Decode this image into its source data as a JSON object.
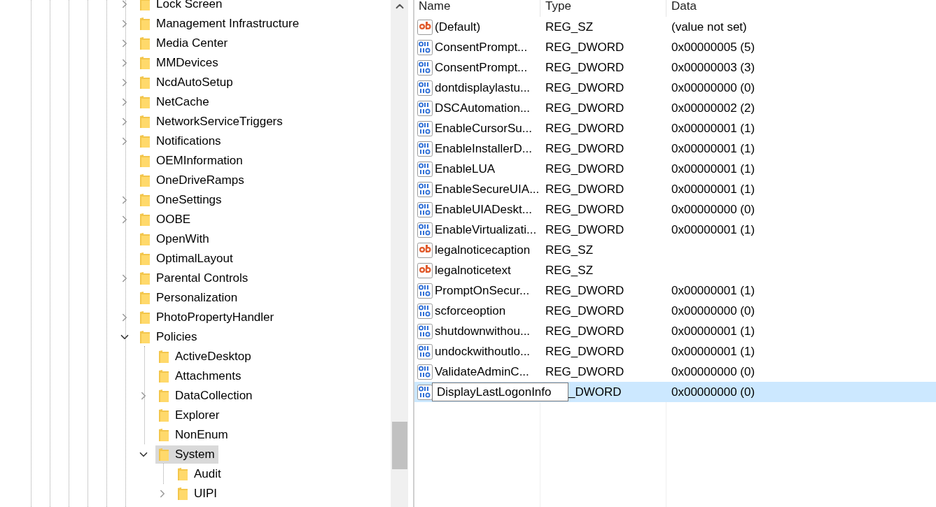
{
  "tree": [
    {
      "label": "Lock Screen",
      "expanded": false,
      "selected": false
    },
    {
      "label": "Management Infrastructure",
      "expanded": false,
      "selected": false
    },
    {
      "label": "Media Center",
      "expanded": false,
      "selected": false
    },
    {
      "label": "MMDevices",
      "expanded": false,
      "selected": false
    },
    {
      "label": "NcdAutoSetup",
      "expanded": false,
      "selected": false
    },
    {
      "label": "NetCache",
      "expanded": false,
      "selected": false
    },
    {
      "label": "NetworkServiceTriggers",
      "expanded": false,
      "selected": false
    },
    {
      "label": "Notifications",
      "expanded": false,
      "selected": false
    },
    {
      "label": "OEMInformation",
      "selected": false
    },
    {
      "label": "OneDriveRamps",
      "selected": false
    },
    {
      "label": "OneSettings",
      "expanded": false,
      "selected": false
    },
    {
      "label": "OOBE",
      "expanded": false,
      "selected": false
    },
    {
      "label": "OpenWith",
      "selected": false
    },
    {
      "label": "OptimalLayout",
      "selected": false
    },
    {
      "label": "Parental Controls",
      "expanded": false,
      "selected": false
    },
    {
      "label": "Personalization",
      "selected": false
    },
    {
      "label": "PhotoPropertyHandler",
      "expanded": false,
      "selected": false
    },
    {
      "label": "Policies",
      "expanded": true,
      "selected": false,
      "children": [
        {
          "label": "ActiveDesktop",
          "selected": false
        },
        {
          "label": "Attachments",
          "selected": false
        },
        {
          "label": "DataCollection",
          "expanded": false,
          "selected": false
        },
        {
          "label": "Explorer",
          "selected": false
        },
        {
          "label": "NonEnum",
          "selected": false
        },
        {
          "label": "System",
          "expanded": true,
          "selected": true,
          "children": [
            {
              "label": "Audit",
              "selected": false
            },
            {
              "label": "UIPI",
              "expanded": false,
              "selected": false
            }
          ]
        }
      ]
    }
  ],
  "values": {
    "columns": [
      "Name",
      "Type",
      "Data"
    ],
    "rows": [
      {
        "kind": "string",
        "name": "(Default)",
        "type": "REG_SZ",
        "data": "(value not set)",
        "selected": false,
        "editing": false
      },
      {
        "kind": "dword",
        "name": "ConsentPrompt...",
        "type": "REG_DWORD",
        "data": "0x00000005 (5)",
        "selected": false,
        "editing": false
      },
      {
        "kind": "dword",
        "name": "ConsentPrompt...",
        "type": "REG_DWORD",
        "data": "0x00000003 (3)",
        "selected": false,
        "editing": false
      },
      {
        "kind": "dword",
        "name": "dontdisplaylastu...",
        "type": "REG_DWORD",
        "data": "0x00000000 (0)",
        "selected": false,
        "editing": false
      },
      {
        "kind": "dword",
        "name": "DSCAutomation...",
        "type": "REG_DWORD",
        "data": "0x00000002 (2)",
        "selected": false,
        "editing": false
      },
      {
        "kind": "dword",
        "name": "EnableCursorSu...",
        "type": "REG_DWORD",
        "data": "0x00000001 (1)",
        "selected": false,
        "editing": false
      },
      {
        "kind": "dword",
        "name": "EnableInstallerD...",
        "type": "REG_DWORD",
        "data": "0x00000001 (1)",
        "selected": false,
        "editing": false
      },
      {
        "kind": "dword",
        "name": "EnableLUA",
        "type": "REG_DWORD",
        "data": "0x00000001 (1)",
        "selected": false,
        "editing": false
      },
      {
        "kind": "dword",
        "name": "EnableSecureUIA...",
        "type": "REG_DWORD",
        "data": "0x00000001 (1)",
        "selected": false,
        "editing": false
      },
      {
        "kind": "dword",
        "name": "EnableUIADeskt...",
        "type": "REG_DWORD",
        "data": "0x00000000 (0)",
        "selected": false,
        "editing": false
      },
      {
        "kind": "dword",
        "name": "EnableVirtualizati...",
        "type": "REG_DWORD",
        "data": "0x00000001 (1)",
        "selected": false,
        "editing": false
      },
      {
        "kind": "string",
        "name": "legalnoticecaption",
        "type": "REG_SZ",
        "selected": false,
        "editing": false
      },
      {
        "kind": "string",
        "name": "legalnoticetext",
        "type": "REG_SZ",
        "selected": false,
        "editing": false
      },
      {
        "kind": "dword",
        "name": "PromptOnSecur...",
        "type": "REG_DWORD",
        "data": "0x00000001 (1)",
        "selected": false,
        "editing": false
      },
      {
        "kind": "dword",
        "name": "scforceoption",
        "type": "REG_DWORD",
        "data": "0x00000000 (0)",
        "selected": false,
        "editing": false
      },
      {
        "kind": "dword",
        "name": "shutdownwithou...",
        "type": "REG_DWORD",
        "data": "0x00000001 (1)",
        "selected": false,
        "editing": false
      },
      {
        "kind": "dword",
        "name": "undockwithoutlo...",
        "type": "REG_DWORD",
        "data": "0x00000001 (1)",
        "selected": false,
        "editing": false
      },
      {
        "kind": "dword",
        "name": "ValidateAdminC...",
        "type": "REG_DWORD",
        "data": "0x00000000 (0)",
        "selected": false,
        "editing": false
      },
      {
        "kind": "dword",
        "name": "DisplayLastLogonInfo",
        "type": "_DWORD",
        "data": "0x00000000 (0)",
        "selected": true,
        "editing": true
      }
    ]
  }
}
